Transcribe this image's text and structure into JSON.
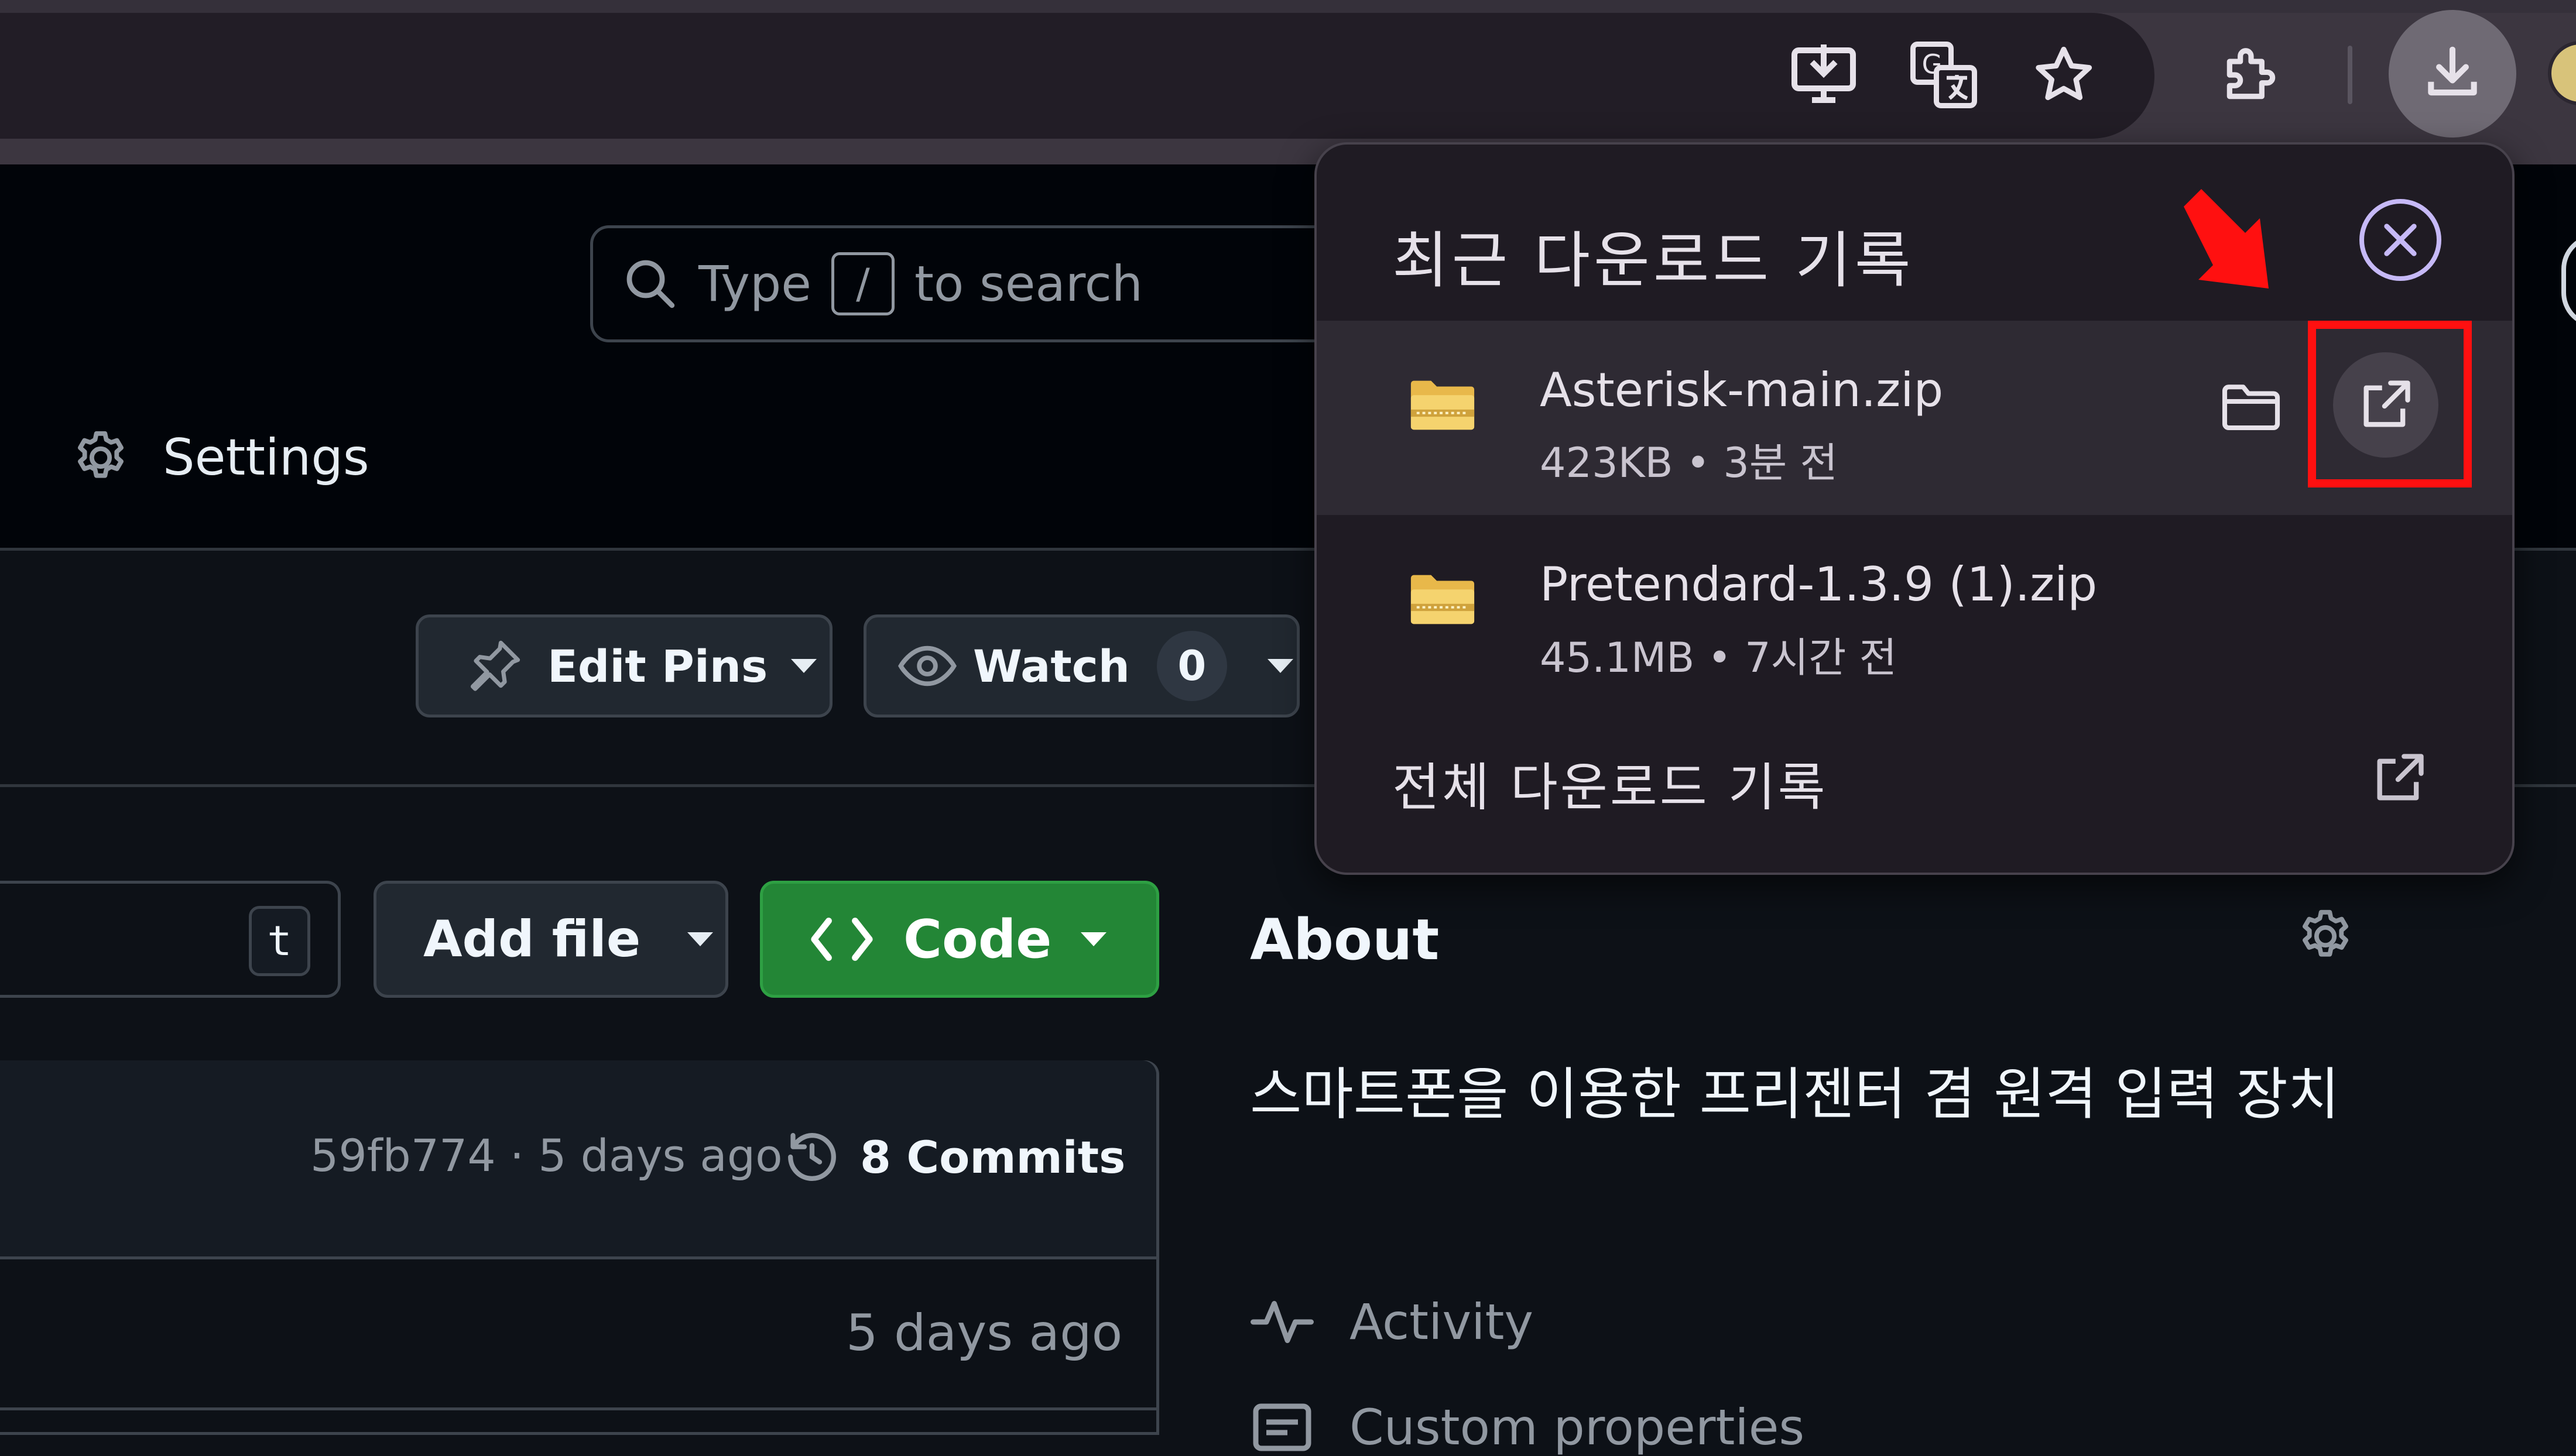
{
  "browser": {
    "toolbar_icons": [
      "install-app-icon",
      "translate-icon",
      "bookmark-star-icon",
      "extensions-icon",
      "download-icon"
    ]
  },
  "github": {
    "search": {
      "label_before": "Type",
      "kbd": "/",
      "label_after": "to search"
    },
    "settings_tab": "Settings",
    "edit_pins": "Edit Pins",
    "watch": {
      "label": "Watch",
      "count": "0"
    },
    "goto_kbd": "t",
    "add_file": "Add file",
    "code": "Code",
    "latest_commit": "59fb774 · 5 days ago",
    "commits": "8 Commits",
    "row2_time": "5 days ago",
    "about": {
      "title": "About",
      "description": "스마트폰을 이용한 프리젠터 겸 원격 입력 장치",
      "activity": "Activity",
      "custom_properties": "Custom properties"
    }
  },
  "downloads": {
    "title": "최근 다운로드 기록",
    "items": [
      {
        "name": "Asterisk-main.zip",
        "size": "423KB",
        "time": "3분 전",
        "meta": "423KB • 3분 전"
      },
      {
        "name": "Pretendard-1.3.9 (1).zip",
        "size": "45.1MB",
        "time": "7시간 전",
        "meta": "45.1MB • 7시간 전"
      }
    ],
    "all_history": "전체 다운로드 기록"
  },
  "colors": {
    "code_button": "#238636",
    "highlight": "#ff1010",
    "popup_bg": "#1f1b23",
    "close_ring": "#c6b9f7"
  }
}
